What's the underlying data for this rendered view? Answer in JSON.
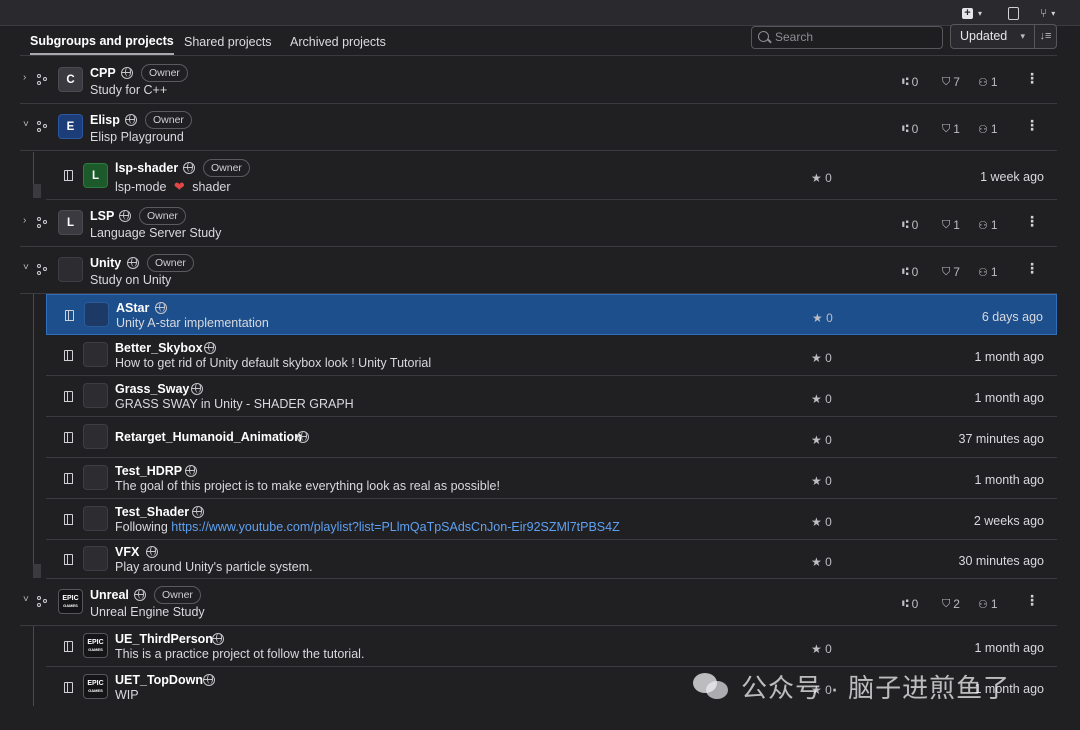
{
  "tabs": [
    "Subgroups and projects",
    "Shared projects",
    "Archived projects"
  ],
  "search": {
    "placeholder": "Search"
  },
  "sort": {
    "label": "Updated"
  },
  "groups": [
    {
      "avatar": "C",
      "name": "CPP",
      "badge": "Owner",
      "desc": "Study for C++",
      "subgroups": "0",
      "projects": "7",
      "members": "1",
      "expanded": false
    },
    {
      "avatar": "E",
      "name": "Elisp",
      "badge": "Owner",
      "desc": "Elisp Playground",
      "subgroups": "0",
      "projects": "1",
      "members": "1",
      "expanded": true
    },
    {
      "avatar": "L",
      "name": "LSP",
      "badge": "Owner",
      "desc": "Language Server Study",
      "subgroups": "0",
      "projects": "1",
      "members": "1",
      "expanded": false
    },
    {
      "avatar": "",
      "name": "Unity",
      "badge": "Owner",
      "desc": "Study on Unity",
      "subgroups": "0",
      "projects": "7",
      "members": "1",
      "expanded": true
    },
    {
      "avatar": "EPIC GAMES",
      "name": "Unreal",
      "badge": "Owner",
      "desc": "Unreal Engine Study",
      "subgroups": "0",
      "projects": "2",
      "members": "1",
      "expanded": true
    }
  ],
  "projects": [
    {
      "avatar": "L",
      "name": "lsp-shader",
      "badge": "Owner",
      "desc_pre": "lsp-mode",
      "desc_post": "shader",
      "stars": "0",
      "updated": "1 week ago"
    },
    {
      "name": "AStar",
      "desc": "Unity A-star implementation",
      "stars": "0",
      "updated": "6 days ago"
    },
    {
      "name": "Better_Skybox",
      "desc": "How to get rid of Unity default skybox look ! Unity Tutorial",
      "stars": "0",
      "updated": "1 month ago"
    },
    {
      "name": "Grass_Sway",
      "desc": "GRASS SWAY in Unity - SHADER GRAPH",
      "stars": "0",
      "updated": "1 month ago"
    },
    {
      "name": "Retarget_Humanoid_Animation",
      "desc": "",
      "stars": "0",
      "updated": "37 minutes ago"
    },
    {
      "name": "Test_HDRP",
      "desc": "The goal of this project is to make everything look as real as possible!",
      "stars": "0",
      "updated": "1 month ago"
    },
    {
      "name": "Test_Shader",
      "desc_pre": "Following ",
      "link": "https://www.youtube.com/playlist?list=PLlmQaTpSAdsCnJon-Eir92SZMl7tPBS4Z",
      "stars": "0",
      "updated": "2 weeks ago"
    },
    {
      "name": "VFX",
      "desc": "Play around Unity's particle system.",
      "stars": "0",
      "updated": "30 minutes ago"
    },
    {
      "name": "UE_ThirdPerson",
      "desc": "This is a practice project ot follow the tutorial.",
      "stars": "0",
      "updated": "1 month ago"
    },
    {
      "name": "UET_TopDown",
      "desc": "WIP",
      "stars": "0",
      "updated": "1 month ago"
    }
  ],
  "epic_logo": "EPIC GAMES",
  "watermark": "公众号 · 脑子进煎鱼了",
  "colors": {
    "selected_row": "#1c4f8c",
    "link": "#5fa0f0",
    "page_bg": "#202023"
  }
}
